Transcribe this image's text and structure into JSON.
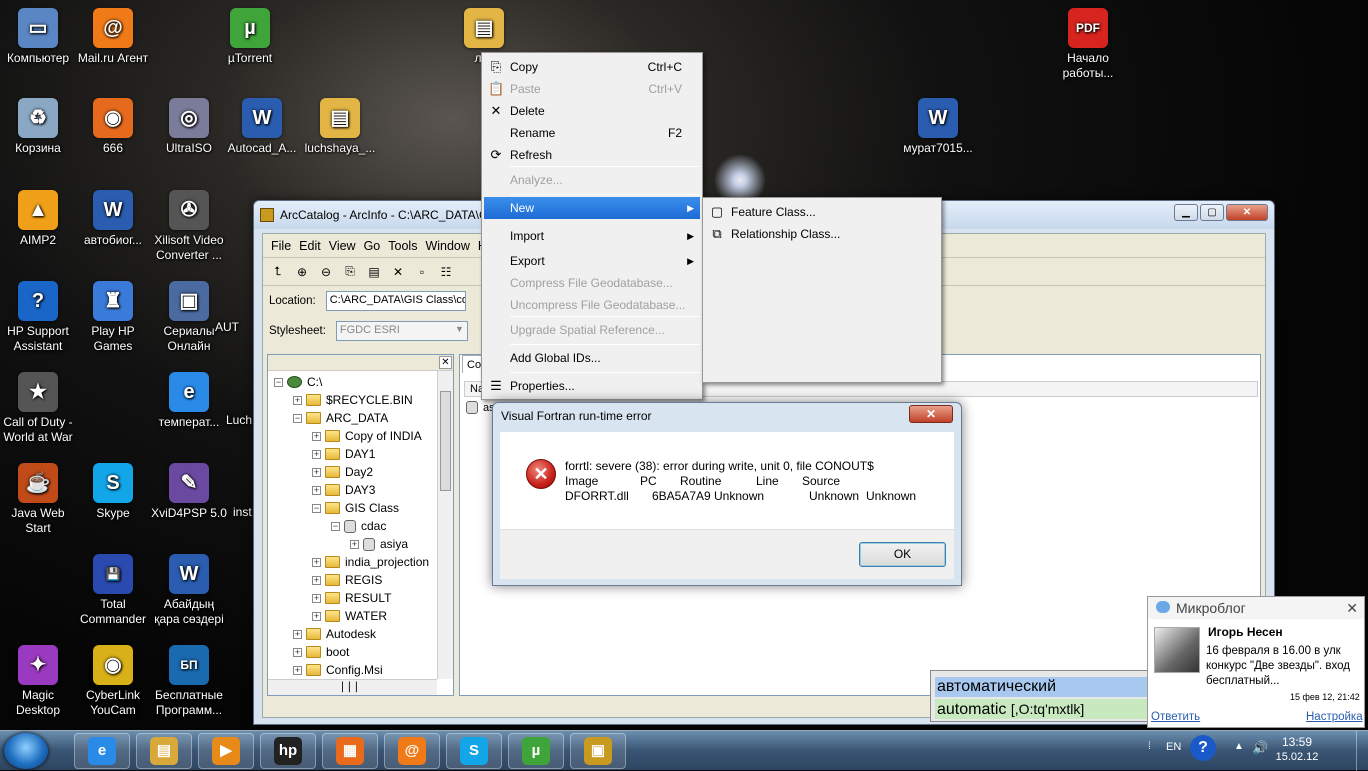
{
  "desktop": {
    "icons": [
      {
        "label": "Компьютер",
        "icon": "computer-icon",
        "color": "#5a86c4",
        "glyph": "▭"
      },
      {
        "label": "Mail.ru Агент",
        "icon": "mail-agent-icon",
        "color": "#f07a18",
        "glyph": "@"
      },
      {
        "label": "µTorrent",
        "icon": "utorrent-icon",
        "color": "#3fa43a",
        "glyph": "µ"
      },
      {
        "label": "Корзина",
        "icon": "recycle-bin-icon",
        "color": "#8aa8c4",
        "glyph": "♻"
      },
      {
        "label": "666",
        "icon": "firefox-icon",
        "color": "#e66a1e",
        "glyph": "◉"
      },
      {
        "label": "UltraISO",
        "icon": "ultraiso-icon",
        "color": "#7b7b9a",
        "glyph": "◎"
      },
      {
        "label": "Autocad_A...",
        "icon": "word-document-icon",
        "color": "#2a5db0",
        "glyph": "W"
      },
      {
        "label": "luchshaya_...",
        "icon": "folder-icon",
        "color": "#e2b544",
        "glyph": "▤"
      },
      {
        "label": "AIMP2",
        "icon": "aimp-icon",
        "color": "#f0a018",
        "glyph": "▲"
      },
      {
        "label": "автобиог...",
        "icon": "word-document-icon",
        "color": "#2a5db0",
        "glyph": "W"
      },
      {
        "label": "Xilisoft Video Converter ...",
        "icon": "film-reel-icon",
        "color": "#555555",
        "glyph": "✇"
      },
      {
        "label": "HP Support Assistant",
        "icon": "help-icon",
        "color": "#1a66c8",
        "glyph": "?"
      },
      {
        "label": "Play HP Games",
        "icon": "hp-games-icon",
        "color": "#3a7ad8",
        "glyph": "♜"
      },
      {
        "label": "Сериалы Онлайн",
        "icon": "tv-icon",
        "color": "#4a6aa0",
        "glyph": "▣"
      },
      {
        "label": "Call of Duty - World at War",
        "icon": "call-of-duty-icon",
        "color": "#555555",
        "glyph": "★"
      },
      {
        "label": "температ...",
        "icon": "internet-explorer-icon",
        "color": "#2a8ae8",
        "glyph": "e"
      },
      {
        "label": "Java Web Start",
        "icon": "java-icon",
        "color": "#c04a18",
        "glyph": "☕"
      },
      {
        "label": "Skype",
        "icon": "skype-icon",
        "color": "#12a5e8",
        "glyph": "S"
      },
      {
        "label": "XviD4PSP 5.0",
        "icon": "xvid-icon",
        "color": "#6a4aa0",
        "glyph": "✎"
      },
      {
        "label": "Total Commander",
        "icon": "total-commander-icon",
        "color": "#2a4ab0",
        "glyph": "💾"
      },
      {
        "label": "Абайдың қара сөздері",
        "icon": "word-document-icon",
        "color": "#2a5db0",
        "glyph": "W"
      },
      {
        "label": "Magic Desktop",
        "icon": "magic-desktop-icon",
        "color": "#9a3ac0",
        "glyph": "✦"
      },
      {
        "label": "CyberLink YouCam",
        "icon": "youcam-icon",
        "color": "#d8b018",
        "glyph": "◉"
      },
      {
        "label": "Бесплатные Программ...",
        "icon": "free-programs-icon",
        "color": "#1a6ab0",
        "glyph": "БП"
      },
      {
        "label": "Начало работы...",
        "icon": "pdf-icon",
        "color": "#d8241e",
        "glyph": "PDF"
      },
      {
        "label": "мурат7015...",
        "icon": "word-document-icon",
        "color": "#2a5db0",
        "glyph": "W"
      },
      {
        "label": "лек",
        "icon": "folder-icon",
        "color": "#e2b544",
        "glyph": "▤"
      }
    ],
    "partial_labels": [
      "AUT",
      "Luch",
      "inst"
    ]
  },
  "arccatalog": {
    "title": "ArcCatalog - ArcInfo - C:\\ARC_DATA\\G",
    "menu": [
      "File",
      "Edit",
      "View",
      "Go",
      "Tools",
      "Window",
      "H"
    ],
    "location_label": "Location:",
    "location_value": "C:\\ARC_DATA\\GIS Class\\cd",
    "stylesheet_label": "Stylesheet:",
    "stylesheet_value": "FGDC ESRI",
    "contents_tab": "Con",
    "contents_col": "Na",
    "contents_item": "as",
    "tree": [
      {
        "label": "C:\\",
        "level": 0,
        "kind": "drive",
        "exp": "−"
      },
      {
        "label": "$RECYCLE.BIN",
        "level": 1,
        "kind": "folder",
        "exp": "+"
      },
      {
        "label": "ARC_DATA",
        "level": 1,
        "kind": "folder",
        "exp": "−"
      },
      {
        "label": "Copy of INDIA",
        "level": 2,
        "kind": "folder",
        "exp": "+"
      },
      {
        "label": "DAY1",
        "level": 2,
        "kind": "folder",
        "exp": "+"
      },
      {
        "label": "Day2",
        "level": 2,
        "kind": "folder",
        "exp": "+"
      },
      {
        "label": "DAY3",
        "level": 2,
        "kind": "folder",
        "exp": "+"
      },
      {
        "label": "GIS Class",
        "level": 2,
        "kind": "folder",
        "exp": "−"
      },
      {
        "label": "cdac",
        "level": 3,
        "kind": "gdb",
        "exp": "−"
      },
      {
        "label": "asiya",
        "level": 4,
        "kind": "gdb",
        "exp": "+"
      },
      {
        "label": "india_projection",
        "level": 2,
        "kind": "folder",
        "exp": "+"
      },
      {
        "label": "REGIS",
        "level": 2,
        "kind": "folder",
        "exp": "+"
      },
      {
        "label": "RESULT",
        "level": 2,
        "kind": "folder",
        "exp": "+"
      },
      {
        "label": "WATER",
        "level": 2,
        "kind": "folder",
        "exp": "+"
      },
      {
        "label": "Autodesk",
        "level": 1,
        "kind": "folder",
        "exp": "+"
      },
      {
        "label": "boot",
        "level": 1,
        "kind": "folder",
        "exp": "+"
      },
      {
        "label": "Config.Msi",
        "level": 1,
        "kind": "folder",
        "exp": "+"
      }
    ]
  },
  "context_menu": {
    "items": [
      {
        "label": "Copy",
        "shortcut": "Ctrl+C",
        "disabled": false,
        "icon": "copy-icon",
        "glyph": "⎘"
      },
      {
        "label": "Paste",
        "shortcut": "Ctrl+V",
        "disabled": true,
        "icon": "paste-icon",
        "glyph": "📋"
      },
      {
        "label": "Delete",
        "shortcut": "",
        "disabled": false,
        "icon": "delete-icon",
        "glyph": "✕"
      },
      {
        "label": "Rename",
        "shortcut": "F2",
        "disabled": false,
        "icon": "",
        "glyph": ""
      },
      {
        "label": "Refresh",
        "shortcut": "",
        "disabled": false,
        "icon": "refresh-icon",
        "glyph": "⟳"
      },
      {
        "label": "Analyze...",
        "shortcut": "",
        "disabled": true,
        "icon": "",
        "glyph": ""
      },
      {
        "label": "New",
        "shortcut": "",
        "disabled": false,
        "submenu": true,
        "selected": true,
        "icon": "",
        "glyph": ""
      },
      {
        "label": "Import",
        "shortcut": "",
        "disabled": false,
        "submenu": true,
        "icon": "",
        "glyph": ""
      },
      {
        "label": "Export",
        "shortcut": "",
        "disabled": false,
        "submenu": true,
        "icon": "",
        "glyph": ""
      },
      {
        "label": "Compress File Geodatabase...",
        "shortcut": "",
        "disabled": true,
        "icon": "",
        "glyph": ""
      },
      {
        "label": "Uncompress File Geodatabase...",
        "shortcut": "",
        "disabled": true,
        "icon": "",
        "glyph": ""
      },
      {
        "label": "Upgrade Spatial Reference...",
        "shortcut": "",
        "disabled": true,
        "icon": "",
        "glyph": ""
      },
      {
        "label": "Add Global IDs...",
        "shortcut": "",
        "disabled": false,
        "icon": "",
        "glyph": ""
      },
      {
        "label": "Properties...",
        "shortcut": "",
        "disabled": false,
        "icon": "properties-icon",
        "glyph": "☰"
      }
    ],
    "submenu": [
      {
        "label": "Feature Class...",
        "icon": "feature-class-icon",
        "glyph": "▢"
      },
      {
        "label": "Relationship Class...",
        "icon": "relationship-class-icon",
        "glyph": "⧉"
      }
    ]
  },
  "error_dialog": {
    "title": "Visual Fortran run-time error",
    "line1": "forrtl: severe (38): error during write, unit 0, file CONOUT$",
    "headers": [
      "Image",
      "PC",
      "Routine",
      "Line",
      "Source"
    ],
    "row": [
      "DFORRT.dll",
      "6BA5A7A9",
      "Unknown",
      "Unknown",
      "Unknown"
    ],
    "ok_label": "OK"
  },
  "translator": {
    "ru": "автоматический",
    "en": "automatic",
    "transcription": "[,O:tq'mxtlk]"
  },
  "microblog": {
    "title": "Микроблог",
    "author": "Игорь Несен",
    "text": "16 февраля в 16.00 в улк конкурс \"Две звезды\". вход бесплатный...",
    "time": "15 фев 12, 21:42",
    "reply": "Ответить",
    "settings": "Настройка"
  },
  "taskbar": {
    "apps": [
      {
        "icon": "internet-explorer-icon",
        "glyph": "e",
        "color": "#2a8ae8"
      },
      {
        "icon": "explorer-folder-icon",
        "glyph": "▤",
        "color": "#d8a83a"
      },
      {
        "icon": "media-player-icon",
        "glyph": "▶",
        "color": "#e88a1a"
      },
      {
        "icon": "hp-icon",
        "glyph": "hp",
        "color": "#222222"
      },
      {
        "icon": "office-icon",
        "glyph": "▦",
        "color": "#e86a1a"
      },
      {
        "icon": "mail-agent-icon",
        "glyph": "@",
        "color": "#f07a18"
      },
      {
        "icon": "skype-icon",
        "glyph": "S",
        "color": "#12a5e8"
      },
      {
        "icon": "utorrent-icon",
        "glyph": "µ",
        "color": "#3fa43a"
      },
      {
        "icon": "arccatalog-icon",
        "glyph": "▣",
        "color": "#c89a20"
      }
    ],
    "lang": "EN",
    "time": "13:59",
    "date": "15.02.12"
  }
}
